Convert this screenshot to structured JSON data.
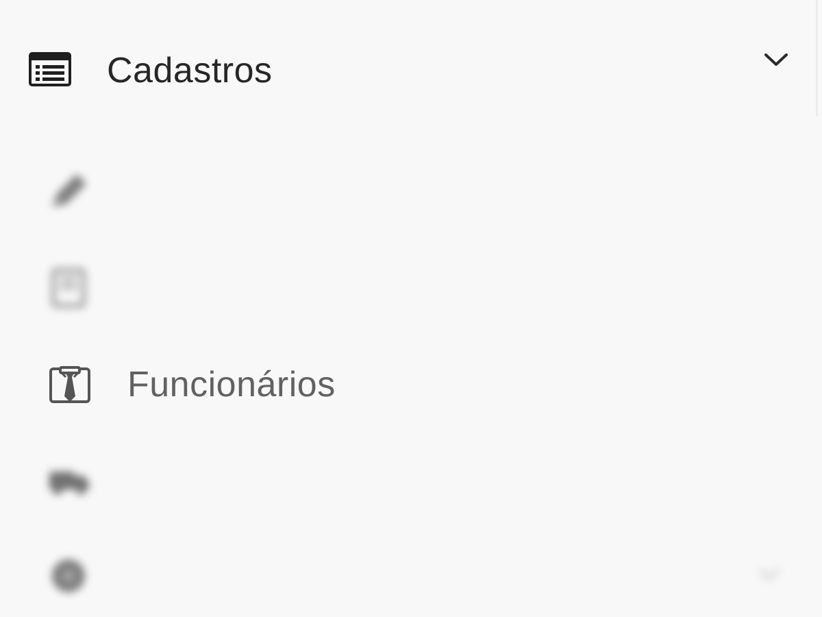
{
  "menu": {
    "section": {
      "label": "Cadastros",
      "icon": "list-card-icon",
      "expanded": true,
      "chevron_icon": "chevron-down-icon"
    },
    "items": [
      {
        "label": "",
        "icon": "pencil-icon",
        "blurred": true
      },
      {
        "label": "",
        "icon": "building-icon",
        "blurred": true
      },
      {
        "label": "Funcionários",
        "icon": "employee-tie-icon",
        "blurred": false
      },
      {
        "label": "",
        "icon": "truck-icon",
        "blurred": true
      },
      {
        "label": "",
        "icon": "gear-icon",
        "blurred": true,
        "has_submenu": true
      }
    ]
  },
  "colors": {
    "background": "#f8f8f8",
    "header_text": "#262626",
    "item_text": "#616161",
    "icon": "#555555"
  }
}
